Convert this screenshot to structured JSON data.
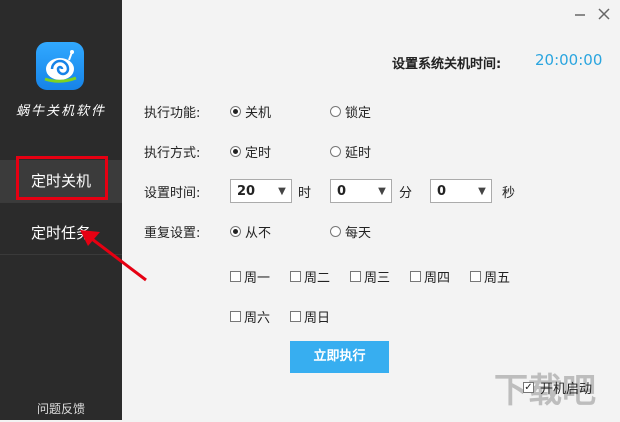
{
  "sidebar": {
    "app_name": "蜗牛关机软件",
    "nav": [
      "定时关机",
      "定时任务"
    ],
    "feedback": "问题反馈"
  },
  "header": {
    "label": "设置系统关机时间:",
    "time": "20:00:00"
  },
  "form": {
    "function": {
      "label": "执行功能:",
      "options": [
        "关机",
        "锁定"
      ],
      "selected": "关机"
    },
    "mode": {
      "label": "执行方式:",
      "options": [
        "定时",
        "延时"
      ],
      "selected": "定时"
    },
    "time": {
      "label": "设置时间:",
      "hour": "20",
      "hour_unit": "时",
      "minute": "0",
      "minute_unit": "分",
      "second": "0",
      "second_unit": "秒"
    },
    "repeat": {
      "label": "重复设置:",
      "options": [
        "从不",
        "每天"
      ],
      "selected": "从不"
    },
    "weekdays": [
      "周一",
      "周二",
      "周三",
      "周四",
      "周五",
      "周六",
      "周日"
    ],
    "execute_button": "立即执行",
    "autostart": {
      "label": "开机启动",
      "checked": true
    }
  },
  "icons": [
    "minimize-icon",
    "close-icon",
    "snail-logo-icon",
    "dropdown-arrow-icon",
    "red-arrow-annotation"
  ],
  "colors": {
    "accent": "#37aef0",
    "time": "#2aa5df",
    "highlight": "#e60012",
    "sidebar": "#2b2b2b"
  },
  "watermark": "下载吧"
}
